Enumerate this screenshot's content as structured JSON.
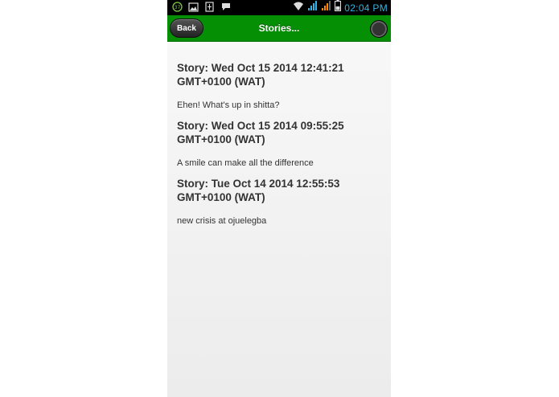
{
  "status_bar": {
    "notification_badge": "37",
    "time": "02:04 PM",
    "icons": [
      "notification-count-icon",
      "image-icon",
      "sim-card-icon",
      "message-icon",
      "wifi-icon",
      "signal-icon",
      "signal-icon-2",
      "battery-icon"
    ],
    "time_color": "#33b5e5"
  },
  "header": {
    "back_label": "Back",
    "title": "Stories...",
    "accent_color": "#058f04"
  },
  "stories": [
    {
      "title": "Story: Wed Oct 15 2014 12:41:21 GMT+0100 (WAT)",
      "body": "Ehen! What's up in shitta?"
    },
    {
      "title": "Story: Wed Oct 15 2014 09:55:25 GMT+0100 (WAT)",
      "body": "A smile can make all the difference"
    },
    {
      "title": "Story: Tue Oct 14 2014 12:55:53 GMT+0100 (WAT)",
      "body": "new crisis at ojuelegba"
    }
  ]
}
